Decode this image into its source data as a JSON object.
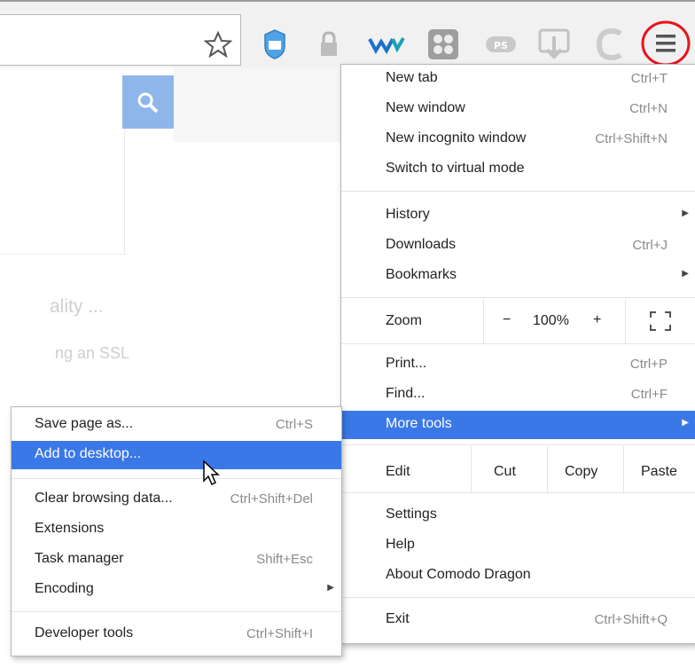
{
  "toolbar": {
    "icons": [
      "bookmark-star-icon",
      "shield-icon",
      "lock-icon",
      "extension-w-icon",
      "apps-grid-icon",
      "ps-icon",
      "download-icon",
      "comodo-c-icon",
      "menu-icon"
    ],
    "menu_highlight_color": "#e8141c"
  },
  "page": {
    "faded_line1": "ality ...",
    "faded_line2": "ng an SSL"
  },
  "main_menu": {
    "new_tab": {
      "label": "New tab",
      "shortcut": "Ctrl+T"
    },
    "new_window": {
      "label": "New window",
      "shortcut": "Ctrl+N"
    },
    "new_incognito": {
      "label": "New incognito window",
      "shortcut": "Ctrl+Shift+N"
    },
    "virtual_mode": {
      "label": "Switch to virtual mode"
    },
    "history": {
      "label": "History"
    },
    "downloads": {
      "label": "Downloads",
      "shortcut": "Ctrl+J"
    },
    "bookmarks": {
      "label": "Bookmarks"
    },
    "zoom": {
      "label": "Zoom",
      "minus": "−",
      "value": "100%",
      "plus": "+"
    },
    "print": {
      "label": "Print...",
      "shortcut": "Ctrl+P"
    },
    "find": {
      "label": "Find...",
      "shortcut": "Ctrl+F"
    },
    "more_tools": {
      "label": "More tools"
    },
    "edit": {
      "label": "Edit",
      "cut": "Cut",
      "copy": "Copy",
      "paste": "Paste"
    },
    "settings": {
      "label": "Settings"
    },
    "help": {
      "label": "Help"
    },
    "about": {
      "label": "About Comodo Dragon"
    },
    "exit": {
      "label": "Exit",
      "shortcut": "Ctrl+Shift+Q"
    }
  },
  "submenu": {
    "save_page": {
      "label": "Save page as...",
      "shortcut": "Ctrl+S"
    },
    "add_desktop": {
      "label": "Add to desktop..."
    },
    "clear_data": {
      "label": "Clear browsing data...",
      "shortcut": "Ctrl+Shift+Del"
    },
    "extensions": {
      "label": "Extensions"
    },
    "task_manager": {
      "label": "Task manager",
      "shortcut": "Shift+Esc"
    },
    "encoding": {
      "label": "Encoding"
    },
    "dev_tools": {
      "label": "Developer tools",
      "shortcut": "Ctrl+Shift+I"
    }
  },
  "colors": {
    "highlight": "#3b78e7",
    "accent": "#e8141c"
  }
}
